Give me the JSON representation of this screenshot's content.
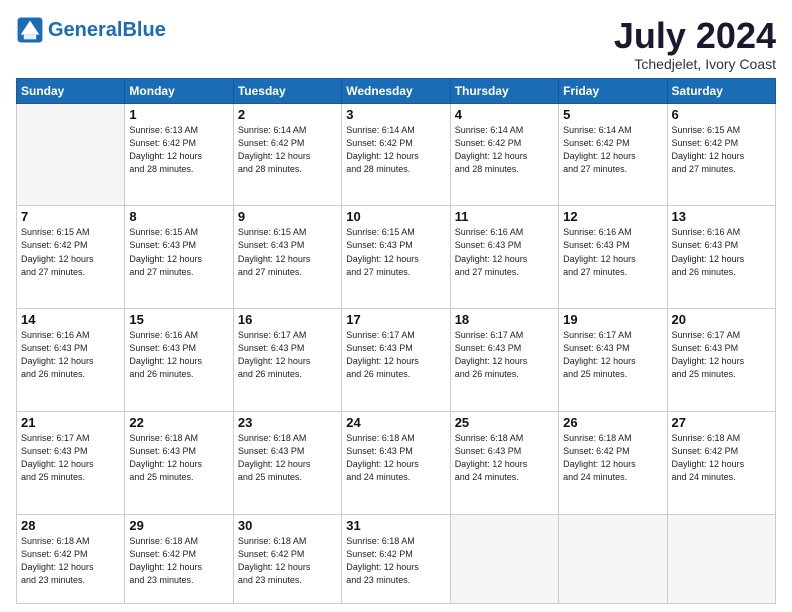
{
  "logo": {
    "text_general": "General",
    "text_blue": "Blue"
  },
  "title": "July 2024",
  "subtitle": "Tchedjelet, Ivory Coast",
  "days_of_week": [
    "Sunday",
    "Monday",
    "Tuesday",
    "Wednesday",
    "Thursday",
    "Friday",
    "Saturday"
  ],
  "weeks": [
    [
      {
        "day": "",
        "info": ""
      },
      {
        "day": "1",
        "info": "Sunrise: 6:13 AM\nSunset: 6:42 PM\nDaylight: 12 hours\nand 28 minutes."
      },
      {
        "day": "2",
        "info": "Sunrise: 6:14 AM\nSunset: 6:42 PM\nDaylight: 12 hours\nand 28 minutes."
      },
      {
        "day": "3",
        "info": "Sunrise: 6:14 AM\nSunset: 6:42 PM\nDaylight: 12 hours\nand 28 minutes."
      },
      {
        "day": "4",
        "info": "Sunrise: 6:14 AM\nSunset: 6:42 PM\nDaylight: 12 hours\nand 28 minutes."
      },
      {
        "day": "5",
        "info": "Sunrise: 6:14 AM\nSunset: 6:42 PM\nDaylight: 12 hours\nand 27 minutes."
      },
      {
        "day": "6",
        "info": "Sunrise: 6:15 AM\nSunset: 6:42 PM\nDaylight: 12 hours\nand 27 minutes."
      }
    ],
    [
      {
        "day": "7",
        "info": "Sunrise: 6:15 AM\nSunset: 6:42 PM\nDaylight: 12 hours\nand 27 minutes."
      },
      {
        "day": "8",
        "info": "Sunrise: 6:15 AM\nSunset: 6:43 PM\nDaylight: 12 hours\nand 27 minutes."
      },
      {
        "day": "9",
        "info": "Sunrise: 6:15 AM\nSunset: 6:43 PM\nDaylight: 12 hours\nand 27 minutes."
      },
      {
        "day": "10",
        "info": "Sunrise: 6:15 AM\nSunset: 6:43 PM\nDaylight: 12 hours\nand 27 minutes."
      },
      {
        "day": "11",
        "info": "Sunrise: 6:16 AM\nSunset: 6:43 PM\nDaylight: 12 hours\nand 27 minutes."
      },
      {
        "day": "12",
        "info": "Sunrise: 6:16 AM\nSunset: 6:43 PM\nDaylight: 12 hours\nand 27 minutes."
      },
      {
        "day": "13",
        "info": "Sunrise: 6:16 AM\nSunset: 6:43 PM\nDaylight: 12 hours\nand 26 minutes."
      }
    ],
    [
      {
        "day": "14",
        "info": "Sunrise: 6:16 AM\nSunset: 6:43 PM\nDaylight: 12 hours\nand 26 minutes."
      },
      {
        "day": "15",
        "info": "Sunrise: 6:16 AM\nSunset: 6:43 PM\nDaylight: 12 hours\nand 26 minutes."
      },
      {
        "day": "16",
        "info": "Sunrise: 6:17 AM\nSunset: 6:43 PM\nDaylight: 12 hours\nand 26 minutes."
      },
      {
        "day": "17",
        "info": "Sunrise: 6:17 AM\nSunset: 6:43 PM\nDaylight: 12 hours\nand 26 minutes."
      },
      {
        "day": "18",
        "info": "Sunrise: 6:17 AM\nSunset: 6:43 PM\nDaylight: 12 hours\nand 26 minutes."
      },
      {
        "day": "19",
        "info": "Sunrise: 6:17 AM\nSunset: 6:43 PM\nDaylight: 12 hours\nand 25 minutes."
      },
      {
        "day": "20",
        "info": "Sunrise: 6:17 AM\nSunset: 6:43 PM\nDaylight: 12 hours\nand 25 minutes."
      }
    ],
    [
      {
        "day": "21",
        "info": "Sunrise: 6:17 AM\nSunset: 6:43 PM\nDaylight: 12 hours\nand 25 minutes."
      },
      {
        "day": "22",
        "info": "Sunrise: 6:18 AM\nSunset: 6:43 PM\nDaylight: 12 hours\nand 25 minutes."
      },
      {
        "day": "23",
        "info": "Sunrise: 6:18 AM\nSunset: 6:43 PM\nDaylight: 12 hours\nand 25 minutes."
      },
      {
        "day": "24",
        "info": "Sunrise: 6:18 AM\nSunset: 6:43 PM\nDaylight: 12 hours\nand 24 minutes."
      },
      {
        "day": "25",
        "info": "Sunrise: 6:18 AM\nSunset: 6:43 PM\nDaylight: 12 hours\nand 24 minutes."
      },
      {
        "day": "26",
        "info": "Sunrise: 6:18 AM\nSunset: 6:42 PM\nDaylight: 12 hours\nand 24 minutes."
      },
      {
        "day": "27",
        "info": "Sunrise: 6:18 AM\nSunset: 6:42 PM\nDaylight: 12 hours\nand 24 minutes."
      }
    ],
    [
      {
        "day": "28",
        "info": "Sunrise: 6:18 AM\nSunset: 6:42 PM\nDaylight: 12 hours\nand 23 minutes."
      },
      {
        "day": "29",
        "info": "Sunrise: 6:18 AM\nSunset: 6:42 PM\nDaylight: 12 hours\nand 23 minutes."
      },
      {
        "day": "30",
        "info": "Sunrise: 6:18 AM\nSunset: 6:42 PM\nDaylight: 12 hours\nand 23 minutes."
      },
      {
        "day": "31",
        "info": "Sunrise: 6:18 AM\nSunset: 6:42 PM\nDaylight: 12 hours\nand 23 minutes."
      },
      {
        "day": "",
        "info": ""
      },
      {
        "day": "",
        "info": ""
      },
      {
        "day": "",
        "info": ""
      }
    ]
  ]
}
